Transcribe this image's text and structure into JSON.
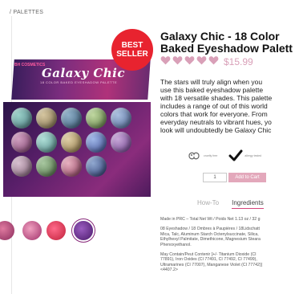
{
  "breadcrumb": "/ PALETTES",
  "badge": {
    "line1": "BEST",
    "line2": "SELLER"
  },
  "product": {
    "title_line1": "Galaxy Chic - 18 Color",
    "title_line2": "Baked Eyeshadow Palett",
    "rating": 5,
    "price": "$15.99",
    "description": [
      "The stars will truly align when you",
      "use this baked eyeshadow palette",
      "with 18 versatile shades. This palette",
      "includes a range of out of this world",
      "colors that work for everyone. From",
      "everyday neutrals to vibrant hues, yo",
      "look will undoubtedly be Galaxy Chic"
    ]
  },
  "palette": {
    "brand": "BH COSMETICS",
    "name": "Galaxy Chic",
    "subtitle": "18 COLOR BAKED EYESHADOW PALETTE"
  },
  "badges": [
    {
      "icon": "cruelty-free-icon",
      "caption": "cruelty free"
    },
    {
      "icon": "checkmark-icon",
      "caption": "allergy tested"
    }
  ],
  "cart": {
    "quantity": "1",
    "add_label": "Add to Cart"
  },
  "tabs": [
    {
      "label": "How-To",
      "active": false
    },
    {
      "label": "Ingredients",
      "active": true
    }
  ],
  "ingredients": {
    "para1": [
      "Made in PRC – Total Net Wt / Poids Net 1.13 oz / 32 g"
    ],
    "para2": [
      "08 Eyeshadow / 18 Ombres à Paupières / 18Lidschatt",
      "Mica, Talc, Aluminum Starch Octenylsuccinate, Silica,",
      "Ethylhexyl Palmitate, Dimethicone, Magnesium Steara",
      "Phenoxyethanol."
    ],
    "para3": [
      "May Contain/Peut Contenir [+/- Titanium Dioxide (CI",
      "77891), Iron Oxides (CI 77491, CI 77492, CI 77499),",
      "Ultramarines (CI 77007), Manganese Violet (CI 77742)]",
      "<4407.2>"
    ]
  },
  "colors": {
    "accent": "#e8232f",
    "heart": "#d9a0b8",
    "add_to_cart": "#e3a8bb",
    "tab_underline": "#d6457a"
  }
}
